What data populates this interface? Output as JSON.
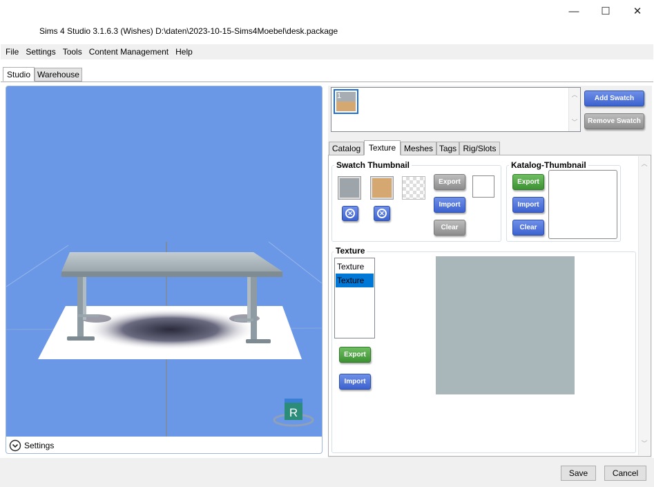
{
  "window": {
    "title": "Sims 4 Studio 3.1.6.3 (Wishes)  D:\\daten\\2023-10-15-Sims4Moebel\\desk.package",
    "minimize": "—",
    "maximize": "☐",
    "close": "✕"
  },
  "menu": [
    "File",
    "Settings",
    "Tools",
    "Content Management",
    "Help"
  ],
  "main_tabs": [
    {
      "label": "Studio",
      "selected": true
    },
    {
      "label": "Warehouse",
      "selected": false
    }
  ],
  "viewport": {
    "settings_label": "Settings",
    "settings_icon": "chevron-down-circle-icon",
    "reset_cube_label": "R"
  },
  "swatches": {
    "items": [
      {
        "label": "1",
        "colors": [
          "#a7aeb3",
          "#d4a870"
        ]
      }
    ],
    "add_label": "Add Swatch",
    "remove_label": "Remove Swatch"
  },
  "sub_tabs": [
    {
      "label": "Catalog",
      "selected": false
    },
    {
      "label": "Texture",
      "selected": true
    },
    {
      "label": "Meshes",
      "selected": false
    },
    {
      "label": "Tags",
      "selected": false
    },
    {
      "label": "Rig/Slots",
      "selected": false
    }
  ],
  "swatch_thumbnail": {
    "title": "Swatch Thumbnail",
    "export_label": "Export",
    "import_label": "Import",
    "clear_label": "Clear",
    "colors": [
      "#9ea5aa",
      "#d4a870"
    ]
  },
  "katalog_thumbnail": {
    "title": "Katalog-Thumbnail",
    "export_label": "Export",
    "import_label": "Import",
    "clear_label": "Clear"
  },
  "texture": {
    "title": "Texture",
    "list": [
      {
        "label": "Texture",
        "selected": false
      },
      {
        "label": "Texture",
        "selected": true
      }
    ],
    "export_label": "Export",
    "import_label": "Import",
    "preview_color": "#aab7ba"
  },
  "footer": {
    "save_label": "Save",
    "cancel_label": "Cancel"
  }
}
